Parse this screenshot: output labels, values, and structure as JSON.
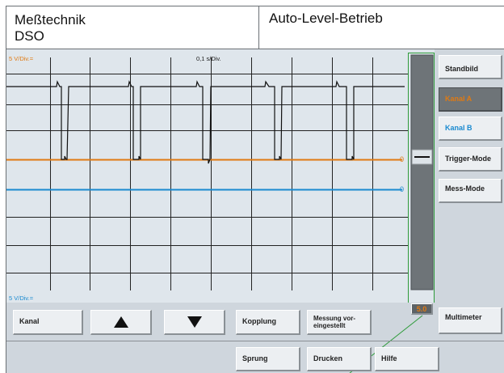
{
  "header": {
    "app_line1": "Meßtechnik",
    "app_line2": "DSO",
    "mode": "Auto-Level-Betrieb"
  },
  "scope": {
    "channel_a_scale": "5 V/Div.=",
    "channel_b_scale": "5 V/Div.=",
    "time_scale": "0,1 s/Div.",
    "ground_a_marker": "0",
    "ground_b_marker": "0",
    "colors": {
      "channel_a": "#e07a12",
      "channel_b": "#1a8ad0",
      "trace": "#111111",
      "grid": "#222222",
      "highlight": "#2e9b3a"
    }
  },
  "level_slider": {
    "value_display": "5.0",
    "level_fraction": 0.28
  },
  "side_buttons": [
    {
      "label": "Standbild",
      "state": "normal"
    },
    {
      "label": "Kanal A",
      "state": "active"
    },
    {
      "label": "Kanal B",
      "state": "blue"
    },
    {
      "label": "Trigger-Mode",
      "state": "normal"
    },
    {
      "label": "Mess-Mode",
      "state": "normal"
    }
  ],
  "bottom_row1": {
    "kanal": "Kanal",
    "up_icon": "arrow-up-icon",
    "down_icon": "arrow-down-icon",
    "kopplung": "Kopplung",
    "messung_line1": "Messung vor-",
    "messung_line2": "eingestellt",
    "multimeter": "Multimeter"
  },
  "bottom_row2": {
    "sprung": "Sprung",
    "drucken": "Drucken",
    "hilfe": "Hilfe"
  }
}
